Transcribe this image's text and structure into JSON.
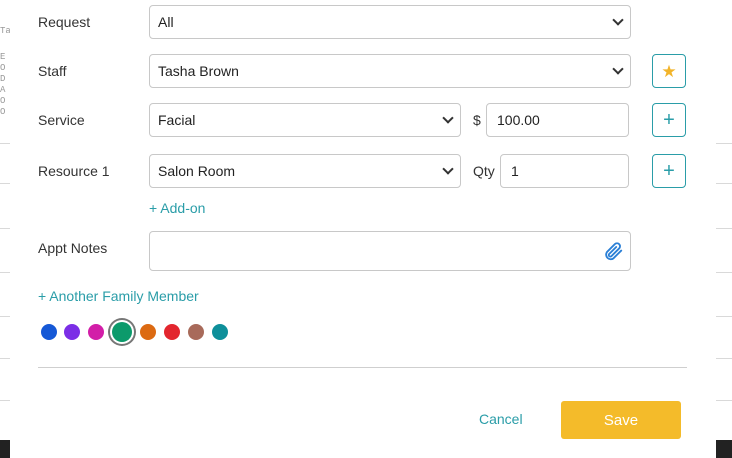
{
  "background": {
    "left_text": [
      "Ta",
      "E",
      "O",
      "D",
      "A",
      "O",
      "O"
    ]
  },
  "form": {
    "request": {
      "label": "Request",
      "value": "All"
    },
    "staff": {
      "label": "Staff",
      "value": "Tasha Brown",
      "favorite_icon": "star-icon"
    },
    "service": {
      "label": "Service",
      "value": "Facial",
      "price_prefix": "$",
      "price": "100.00",
      "add_icon": "plus-icon"
    },
    "resource": {
      "label": "Resource 1",
      "value": "Salon Room",
      "qty_label": "Qty",
      "qty": "1",
      "add_icon": "plus-icon"
    },
    "addon_link": "+ Add-on",
    "notes": {
      "label": "Appt Notes",
      "value": "",
      "attach_icon": "paperclip-icon"
    },
    "family_link": "+ Another Family Member",
    "colors": [
      {
        "hex": "#1558d6",
        "selected": false
      },
      {
        "hex": "#7b2ee6",
        "selected": false
      },
      {
        "hex": "#d21ea8",
        "selected": false
      },
      {
        "hex": "#0c9a6b",
        "selected": true
      },
      {
        "hex": "#dc6a12",
        "selected": false
      },
      {
        "hex": "#e3262e",
        "selected": false
      },
      {
        "hex": "#a86a5a",
        "selected": false
      },
      {
        "hex": "#0e8f9a",
        "selected": false
      }
    ]
  },
  "footer": {
    "cancel_label": "Cancel",
    "save_label": "Save"
  },
  "theme": {
    "accent": "#2a9da8",
    "save_button": "#f4bb2a",
    "star": "#f2b42a"
  }
}
